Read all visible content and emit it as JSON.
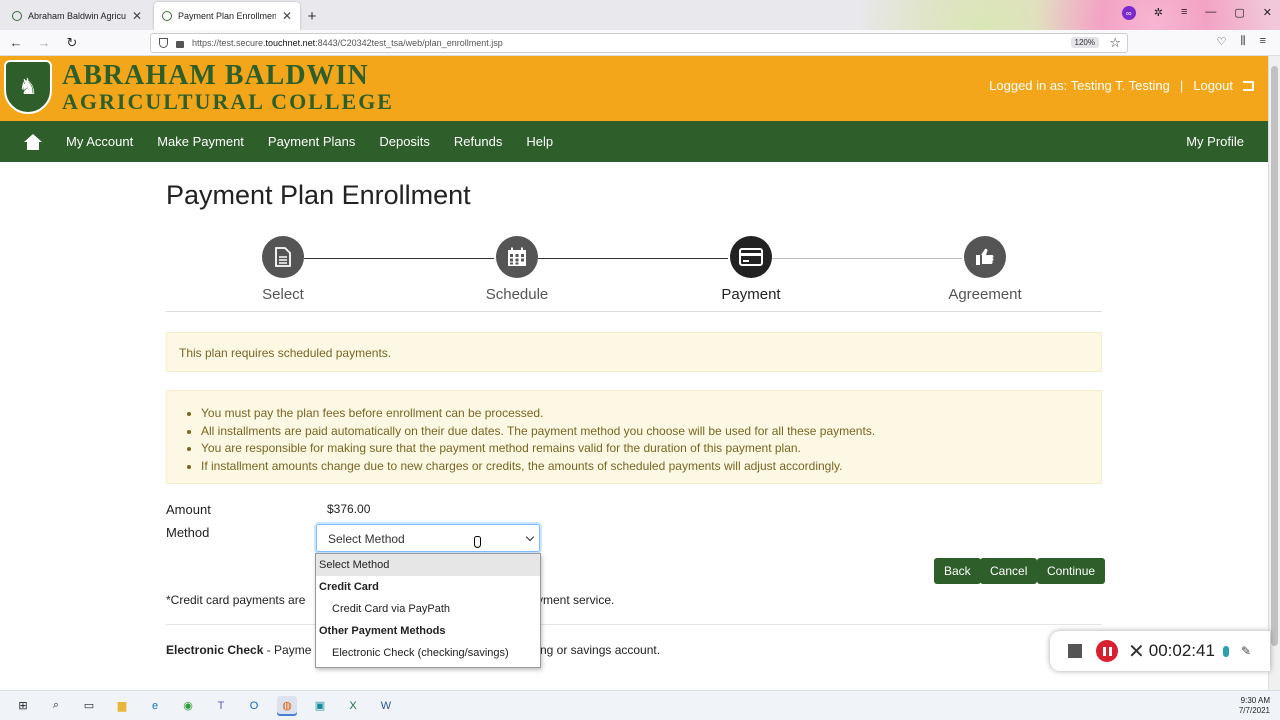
{
  "browser": {
    "tabs": [
      {
        "label": "Abraham Baldwin Agricultural C",
        "active": false
      },
      {
        "label": "Payment Plan Enrollment",
        "active": true
      }
    ],
    "url_prefix": "https://test.secure.",
    "url_host": "touchnet.net",
    "url_rest": ":8443/C20342test_tsa/web/plan_enrollment.jsp",
    "zoom": "120%"
  },
  "header": {
    "logo_line1": "Abraham Baldwin",
    "logo_line2": "Agricultural College",
    "logged_in": "Logged in as: Testing T. Testing",
    "separator": "|",
    "logout": "Logout"
  },
  "nav": {
    "items": [
      "My Account",
      "Make Payment",
      "Payment Plans",
      "Deposits",
      "Refunds",
      "Help"
    ],
    "profile": "My Profile"
  },
  "page": {
    "title": "Payment Plan Enrollment",
    "steps": [
      {
        "label": "Select",
        "icon": "document-icon",
        "active": false
      },
      {
        "label": "Schedule",
        "icon": "calendar-icon",
        "active": false
      },
      {
        "label": "Payment",
        "icon": "credit-card-icon",
        "active": true
      },
      {
        "label": "Agreement",
        "icon": "thumbs-up-icon",
        "active": false
      }
    ],
    "alert": "This plan requires scheduled payments.",
    "info": [
      "You must pay the plan fees before enrollment can be processed.",
      "All installments are paid automatically on their due dates. The payment method you choose will be used for all these payments.",
      "You are responsible for making sure that the payment method remains valid for the duration of this payment plan.",
      "If installment amounts change due to new charges or credits, the amounts of scheduled payments will adjust accordingly."
    ],
    "amount_label": "Amount",
    "amount_value": "$376.00",
    "method_label": "Method",
    "method_selected": "Select Method",
    "dropdown": {
      "placeholder": "Select Method",
      "group1": "Credit Card",
      "option1": "Credit Card via PayPath",
      "group2": "Other Payment Methods",
      "option2": "Electronic Check (checking/savings)"
    },
    "buttons": {
      "back": "Back",
      "cancel": "Cancel",
      "continue": "Continue"
    },
    "note_start": "*Credit card payments are",
    "note_end": "yment service.",
    "echeck_title": "Electronic Check",
    "echeck_start": " - Payme",
    "echeck_end": "ng or savings account."
  },
  "recorder": {
    "time": "00:02:41"
  },
  "taskbar": {
    "time": "9:30 AM",
    "date": "7/7/2021"
  },
  "colors": {
    "brand_green": "#2e5e2a",
    "brand_gold": "#f3a619",
    "alert_bg": "#fcf8e3"
  }
}
